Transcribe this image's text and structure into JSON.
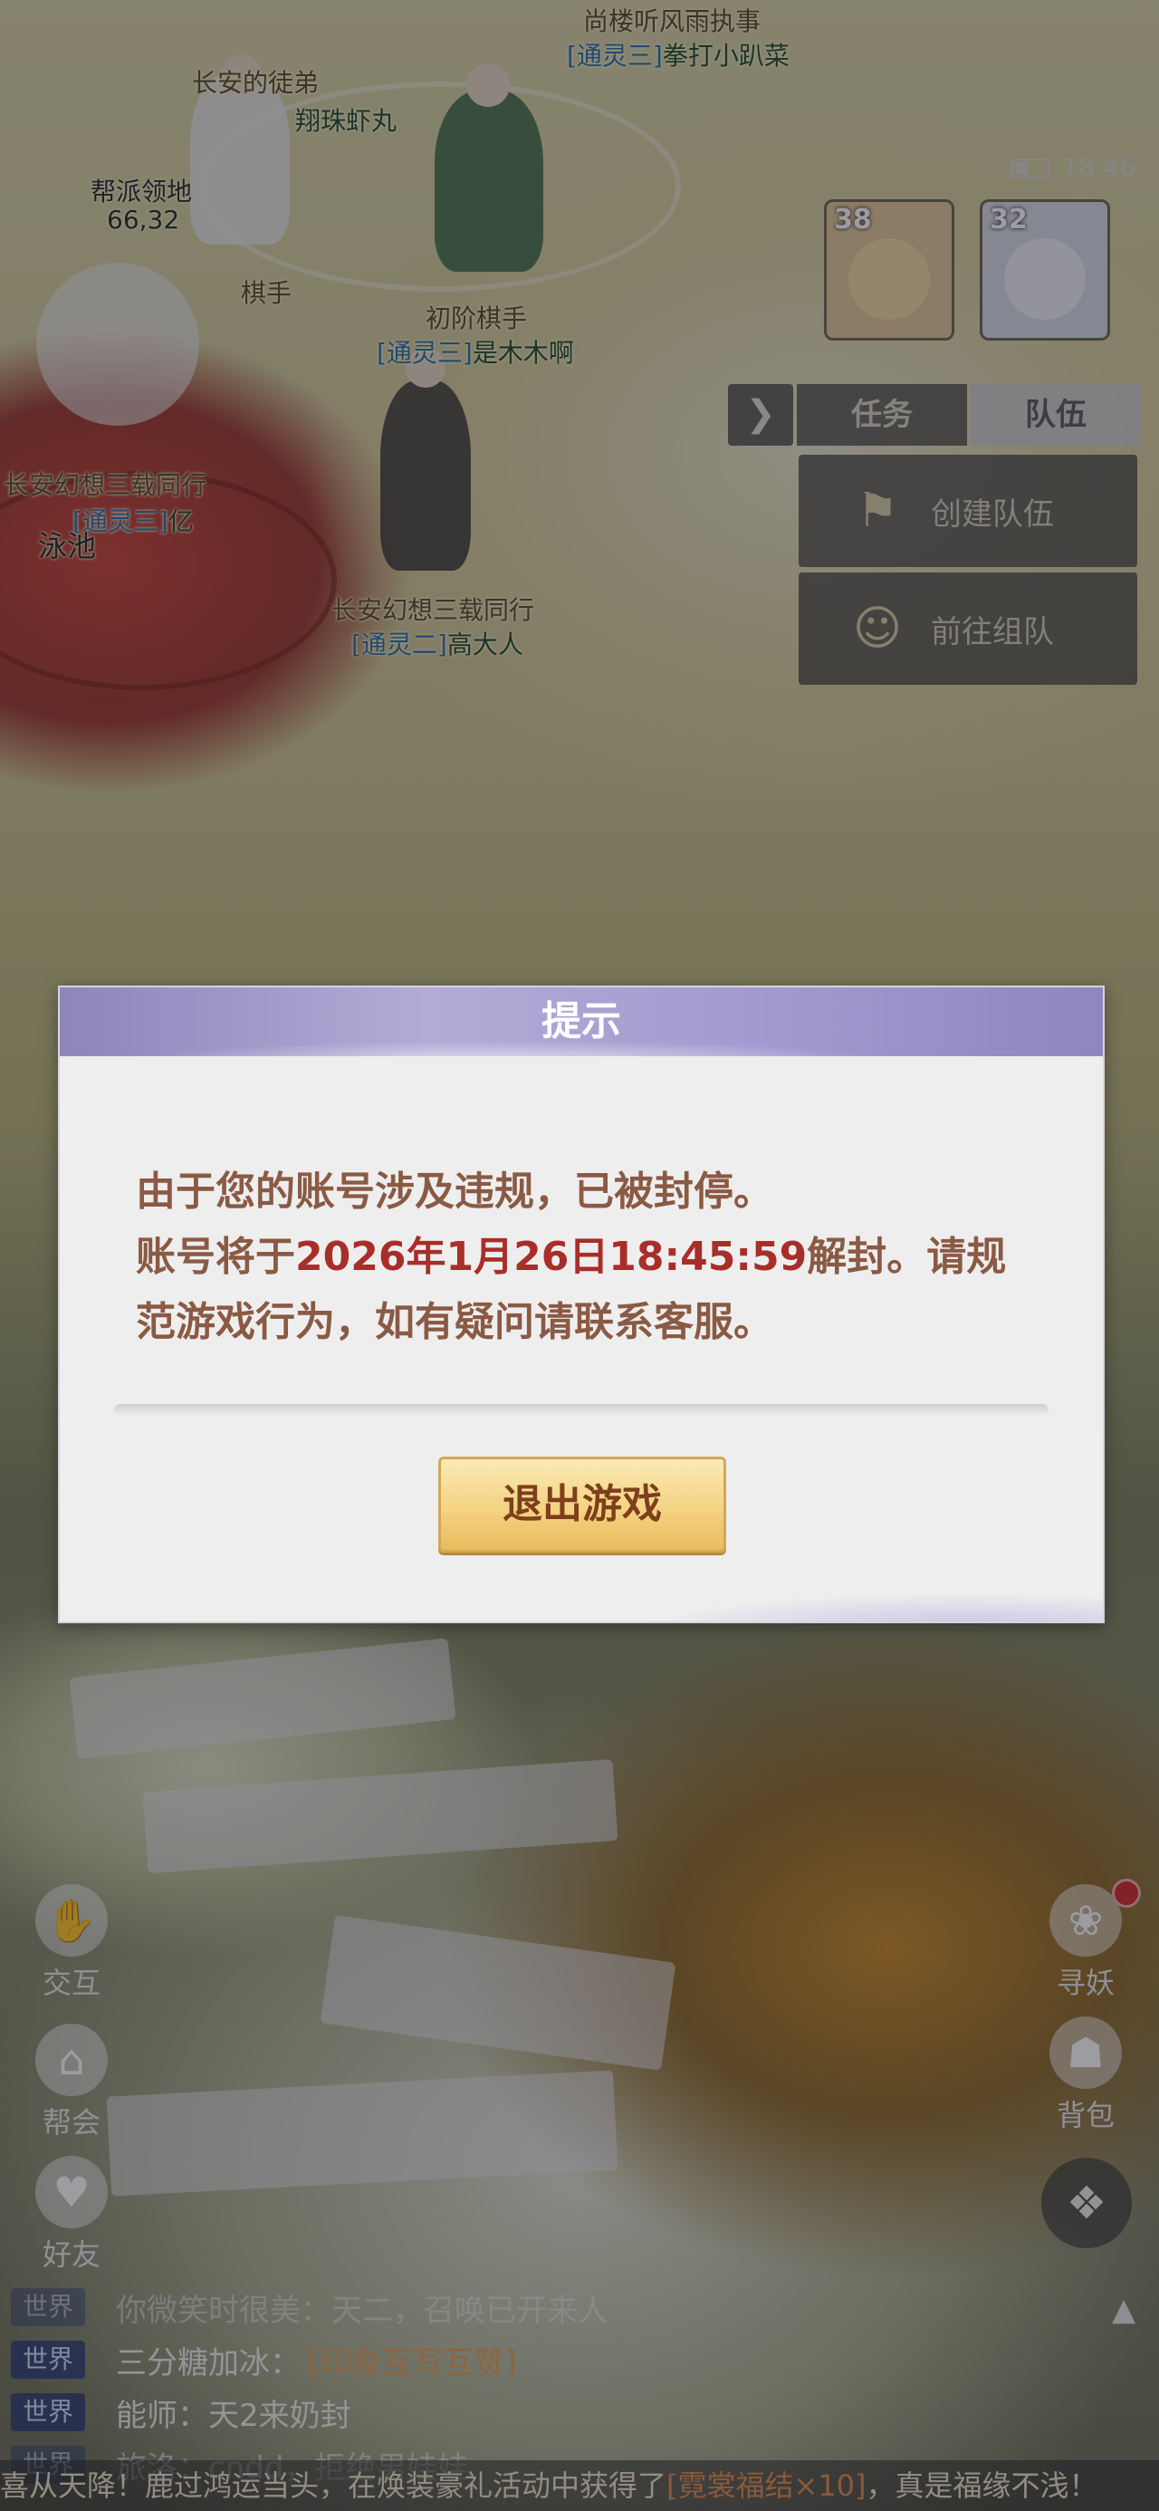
{
  "status_bar": {
    "time": "18:46"
  },
  "scene_labels": [
    {
      "title": "尚楼听风雨执事",
      "tag": "[通灵三]",
      "name": "拳打小趴菜"
    },
    {
      "title": "长安的徒弟",
      "tag": "",
      "name": "翔珠虾丸"
    },
    {
      "title": "帮派领地",
      "tag": "",
      "name": "66,32"
    },
    {
      "title": "棋手",
      "tag": "",
      "name": ""
    },
    {
      "title": "初阶棋手",
      "tag": "[通灵三]",
      "name": "是木木啊"
    },
    {
      "title": "长安幻想三载同行",
      "tag": "[通灵三]",
      "name": "亿"
    },
    {
      "title": "泳池",
      "tag": "",
      "name": ""
    },
    {
      "title": "长安幻想三载同行",
      "tag": "[通灵二]",
      "name": "高大人"
    }
  ],
  "team_avatars": [
    {
      "level": "38"
    },
    {
      "level": "32"
    }
  ],
  "panel": {
    "toggle_icon": "chevron-right-icon",
    "tabs": [
      "任务",
      "队伍"
    ],
    "active_tab": "队伍",
    "create_team": "创建队伍",
    "join_team": "前往组队"
  },
  "left_buttons": [
    {
      "label": "交互",
      "icon": "interact-icon"
    },
    {
      "label": "帮会",
      "icon": "guild-icon"
    },
    {
      "label": "好友",
      "icon": "friends-icon"
    }
  ],
  "right_buttons": [
    {
      "label": "寻妖",
      "icon": "seek-demon-icon",
      "has_red_dot": true
    },
    {
      "label": "背包",
      "icon": "bag-icon",
      "has_red_dot": false
    }
  ],
  "chat": [
    {
      "channel": "世界",
      "text": "你微笑时很美：天二，召唤已开来人",
      "highlight": ""
    },
    {
      "channel": "世界",
      "text": "三分糖加冰：",
      "highlight": "[印象互写互赞]"
    },
    {
      "channel": "世界",
      "text": "能师：天2来奶封",
      "highlight": ""
    },
    {
      "channel": "世界",
      "text": "旅洛：cndd，拒绝男娃娃",
      "highlight": ""
    }
  ],
  "marquee": {
    "before": "喜从天降！鹿过鸿运当头，在焕装豪礼活动中获得了",
    "highlight": "[霓裳福结×10]",
    "after": "，真是福缘不浅！"
  },
  "dialog": {
    "title": "提示",
    "line1": "由于您的账号涉及违规，已被封停。",
    "line2_before": "账号将于",
    "line2_date": "2026年1月26日18:45:59",
    "line2_after": "解封。请规范游戏行为，如有疑问请联系客服。",
    "exit_button": "退出游戏"
  },
  "colors": {
    "dialog_header": "#a49bd0",
    "dialog_text": "#8a5a44",
    "date_red": "#a82e2a",
    "button_gold": "#f4d382",
    "button_text": "#7e3f1c"
  }
}
